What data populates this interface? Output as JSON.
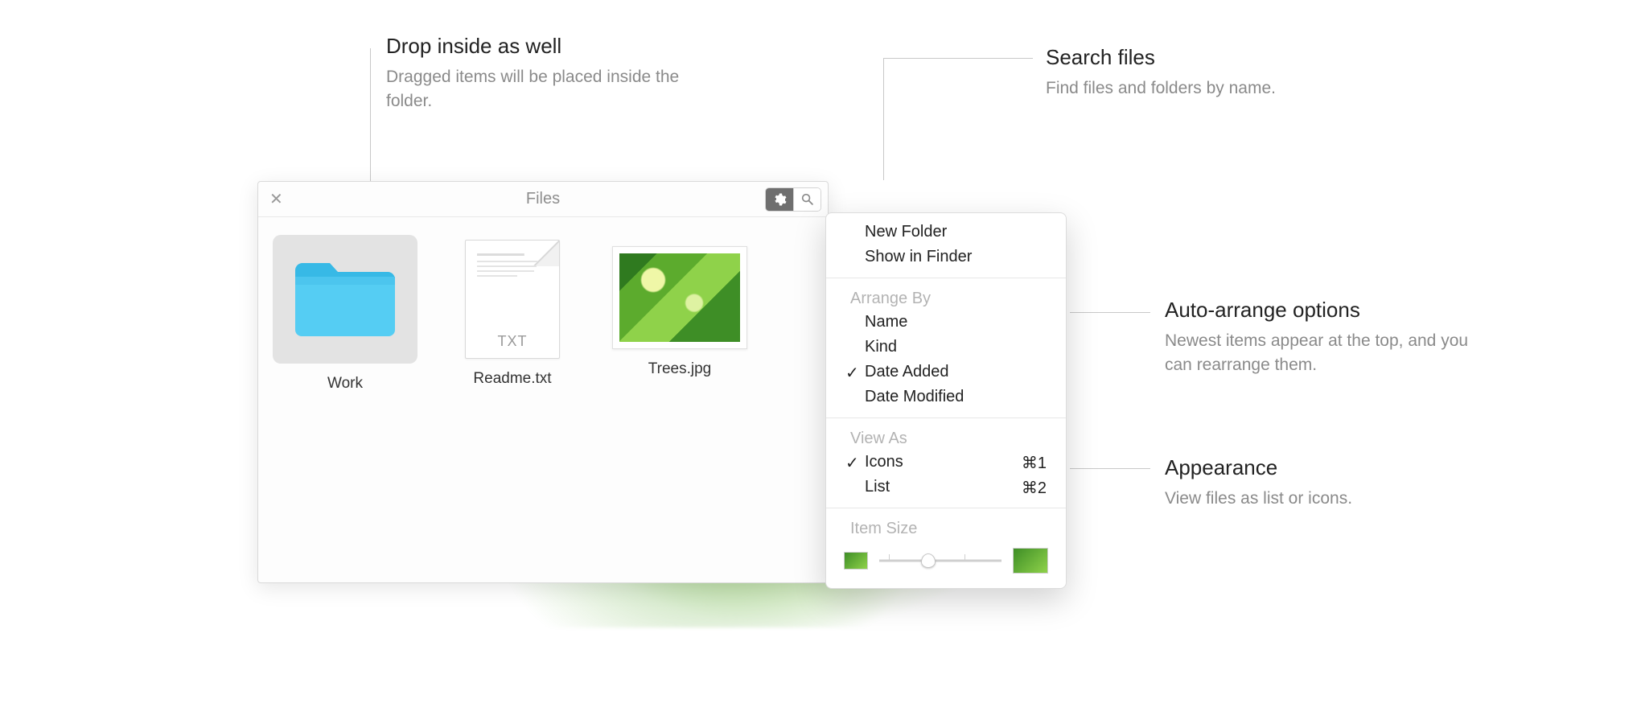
{
  "callouts": {
    "drop": {
      "title": "Drop inside as well",
      "desc": "Dragged items will be placed inside the folder."
    },
    "search": {
      "title": "Search files",
      "desc": "Find files and folders by name."
    },
    "arrange": {
      "title": "Auto-arrange options",
      "desc": "Newest items appear at the top, and you can rearrange them."
    },
    "appearance": {
      "title": "Appearance",
      "desc": "View files as list or icons."
    }
  },
  "window": {
    "title": "Files",
    "items": {
      "folder": {
        "label": "Work"
      },
      "txt": {
        "label": "Readme.txt",
        "badge": "TXT"
      },
      "img": {
        "label": "Trees.jpg"
      }
    }
  },
  "menu": {
    "new_folder": "New Folder",
    "show_in_finder": "Show in Finder",
    "arrange_header": "Arrange By",
    "arrange": {
      "name": "Name",
      "kind": "Kind",
      "date_added": "Date Added",
      "date_modified": "Date Modified"
    },
    "view_header": "View As",
    "view": {
      "icons": {
        "label": "Icons",
        "shortcut": "⌘1"
      },
      "list": {
        "label": "List",
        "shortcut": "⌘2"
      }
    },
    "item_size_header": "Item Size"
  }
}
